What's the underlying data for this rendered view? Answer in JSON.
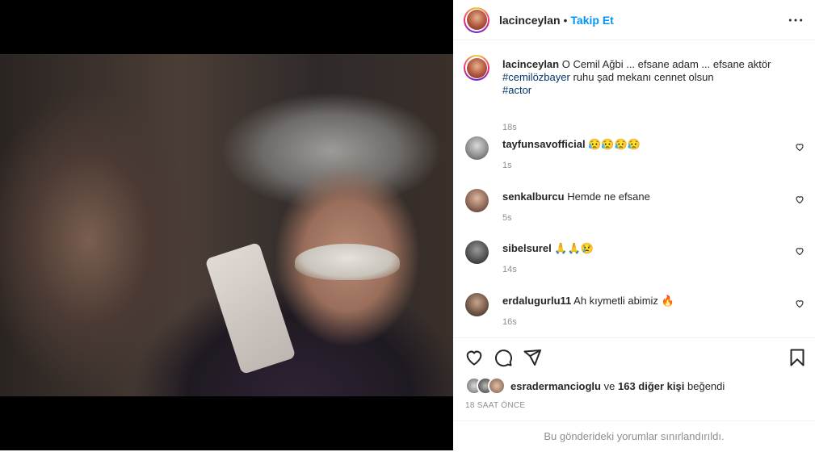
{
  "post": {
    "username": "lacinceylan",
    "separator": "•",
    "follow_label": "Takip Et",
    "caption_user": "lacinceylan",
    "caption_text": "O Cemil Ağbi ... efsane adam ... efsane aktör",
    "hashtag1": "#cemilözbayer",
    "caption_text2": "ruhu şad mekanı cennet olsun",
    "hashtag2": "#actor",
    "caption_time": "18s"
  },
  "comments": [
    {
      "user": "tayfunsavofficial",
      "text": "😥😥😥😥",
      "time": "1s"
    },
    {
      "user": "senkalburcu",
      "text": "Hemde ne efsane",
      "time": "5s"
    },
    {
      "user": "sibelsurel",
      "text": "🙏🙏😢",
      "time": "14s"
    },
    {
      "user": "erdalugurlu11",
      "text": "Ah kıymetli abimiz 🔥",
      "time": "16s"
    }
  ],
  "likes": {
    "user": "esradermancioglu",
    "connector": "ve",
    "others": "163 diğer kişi",
    "suffix": "beğendi"
  },
  "time_ago": "18 SAAT ÖNCE",
  "restricted_notice": "Bu gönderideki yorumlar sınırlandırıldı.",
  "icons": {
    "more": "more-options-icon",
    "like": "heart-icon",
    "comment": "comment-icon",
    "share": "share-icon",
    "save": "bookmark-icon"
  },
  "colors": {
    "accent": "#0095f6",
    "hashtag": "#00376b",
    "muted": "#8e8e8e"
  }
}
